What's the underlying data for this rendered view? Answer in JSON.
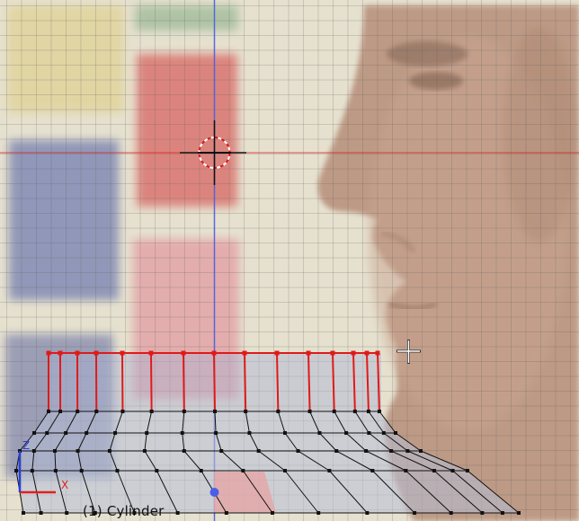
{
  "viewport": {
    "object_label": "(1) Cylinder",
    "axis_labels": {
      "x": "X",
      "z": "Z"
    }
  },
  "colors": {
    "x_axis": "#e02020",
    "y_axis": "#4a5ee8",
    "selected_vertex": "#e01a1a",
    "vertex": "#111111",
    "grid": "#5a5a5a",
    "mesh_face": "#b7bfd7"
  },
  "icons": {
    "cursor": "3d-cursor-icon",
    "pointer": "crosshair-pointer-icon",
    "axes": "axis-gizmo-icon",
    "origin": "object-origin-icon"
  }
}
